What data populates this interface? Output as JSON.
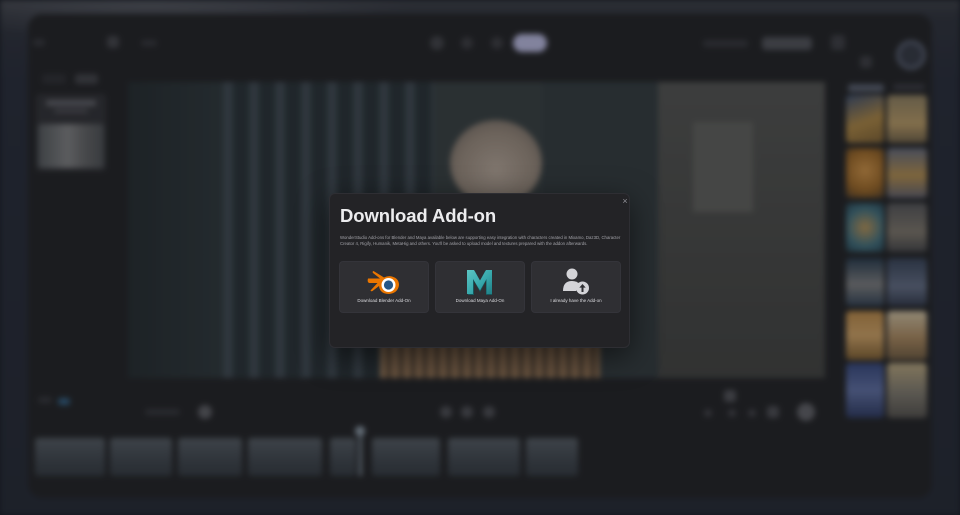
{
  "dialog": {
    "title": "Download Add-on",
    "close_icon": "close-icon",
    "close_glyph": "×",
    "description": "WonderStudio Add-ons for Blender and Maya available below are supporting easy integration with characters created in Mixamo, Daz3D, Character Creator 4, Rigify, Humanik, MetaHig and others. You'll be asked to upload model and textures prepared with the addon afterwards.",
    "options": [
      {
        "label": "Download Blender Add-On",
        "icon": "blender-logo-icon"
      },
      {
        "label": "Download Maya Add-On",
        "icon": "maya-logo-icon"
      },
      {
        "label": "I already have the Add-on",
        "icon": "user-upload-icon"
      }
    ]
  },
  "colors": {
    "dialog_background": "#232326",
    "card_background": "#2f2f33",
    "title_text": "#ececee",
    "body_text": "#a3a3a9",
    "blender_orange": "#ea7600",
    "blender_blue": "#265787",
    "maya_teal": "#37a8ac",
    "accent_purple": "#c8c8f0"
  }
}
